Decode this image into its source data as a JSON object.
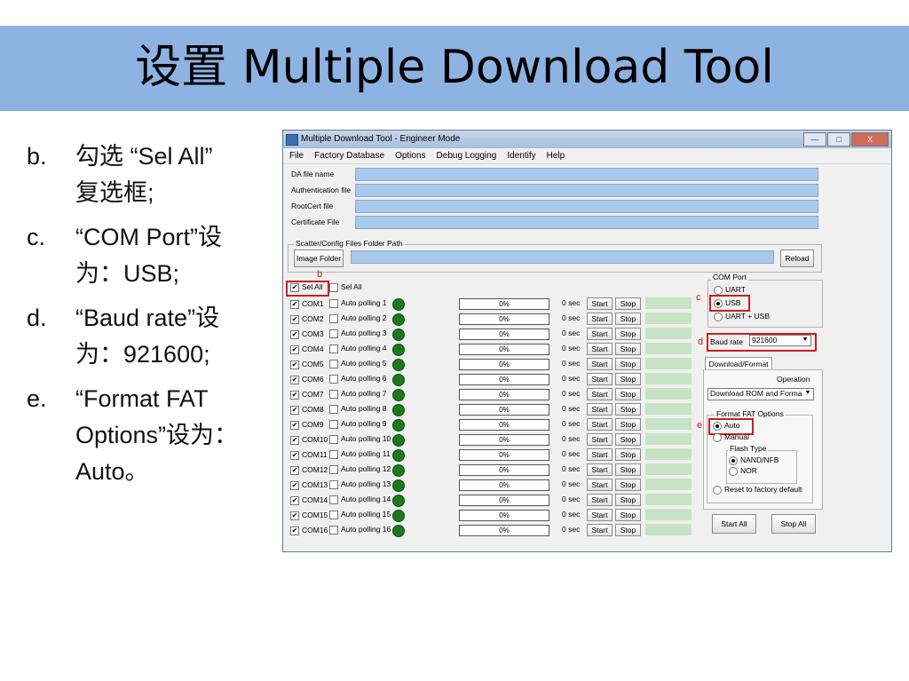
{
  "slide": {
    "title": "设置 Multiple Download Tool",
    "bullets": [
      {
        "marker": "b.",
        "lines": [
          "勾选 “Sel All”",
          "复选框;"
        ]
      },
      {
        "marker": "c.",
        "lines": [
          " “COM Port”设",
          "为：USB;"
        ]
      },
      {
        "marker": "d.",
        "lines": [
          "“Baud rate”设",
          "为：921600;"
        ]
      },
      {
        "marker": "e.",
        "lines": [
          "“Format FAT",
          "Options”设为：",
          "Auto。"
        ]
      }
    ]
  },
  "window": {
    "title": "Multiple Download Tool - Engineer Mode",
    "controls": [
      "—",
      "□",
      "X"
    ],
    "menu": [
      "File",
      "Factory Database",
      "Options",
      "Debug Logging",
      "Identify",
      "Help"
    ],
    "fields": [
      "DA file name",
      "Authentication file",
      "RootCert file",
      "Certificate File"
    ],
    "scatter_group": "Scatter/Config Files Folder Path",
    "image_folder_button": "Image Folder",
    "reload_button": "Reload",
    "sel_all_checked": "Sel All",
    "sel_all": "Sel All",
    "com_rows": [
      {
        "port": "COM1",
        "polling": "Auto polling 1",
        "progress": "0%",
        "time": "0 sec"
      },
      {
        "port": "COM2",
        "polling": "Auto polling 2",
        "progress": "0%",
        "time": "0 sec"
      },
      {
        "port": "COM3",
        "polling": "Auto polling 3",
        "progress": "0%",
        "time": "0 sec"
      },
      {
        "port": "COM4",
        "polling": "Auto polling 4",
        "progress": "0%",
        "time": "0 sec"
      },
      {
        "port": "COM5",
        "polling": "Auto polling 5",
        "progress": "0%",
        "time": "0 sec"
      },
      {
        "port": "COM6",
        "polling": "Auto polling 6",
        "progress": "0%",
        "time": "0 sec"
      },
      {
        "port": "COM7",
        "polling": "Auto polling 7",
        "progress": "0%",
        "time": "0 sec"
      },
      {
        "port": "COM8",
        "polling": "Auto polling 8",
        "progress": "0%",
        "time": "0 sec"
      },
      {
        "port": "COM9",
        "polling": "Auto polling 9",
        "progress": "0%",
        "time": "0 sec"
      },
      {
        "port": "COM10",
        "polling": "Auto polling 10",
        "progress": "0%",
        "time": "0 sec"
      },
      {
        "port": "COM11",
        "polling": "Auto polling 11",
        "progress": "0%",
        "time": "0 sec"
      },
      {
        "port": "COM12",
        "polling": "Auto polling 12",
        "progress": "0%",
        "time": "0 sec"
      },
      {
        "port": "COM13",
        "polling": "Auto polling 13",
        "progress": "0%",
        "time": "0 sec"
      },
      {
        "port": "COM14",
        "polling": "Auto polling 14",
        "progress": "0%",
        "time": "0 sec"
      },
      {
        "port": "COM15",
        "polling": "Auto polling 15",
        "progress": "0%",
        "time": "0 sec"
      },
      {
        "port": "COM16",
        "polling": "Auto polling 16",
        "progress": "0%",
        "time": "0 sec"
      }
    ],
    "start_label": "Start",
    "stop_label": "Stop",
    "com_port_group": "COM Port",
    "com_port_options": [
      "UART",
      "USB",
      "UART + USB"
    ],
    "baud_rate_label": "Baud rate",
    "baud_rate_value": "921600",
    "tab_label": "Download/Format",
    "operation_label": "Operation",
    "operation_value": "Download ROM and Forma",
    "format_fat_group": "Format FAT Options",
    "format_options": [
      "Auto",
      "Manual"
    ],
    "flash_type_group": "Flash  Type",
    "flash_options": [
      "NAND/NFB",
      "NOR"
    ],
    "reset_label": "Reset to factory default",
    "start_all_button": "Start All",
    "stop_all_button": "Stop All",
    "annotations": [
      "b",
      "c",
      "d",
      "e"
    ]
  },
  "colors": {
    "title_band": "#8db3e2",
    "path_field": "#a8c8ec",
    "led": "#1b7a1b",
    "highlight": "#cc1f1f"
  }
}
